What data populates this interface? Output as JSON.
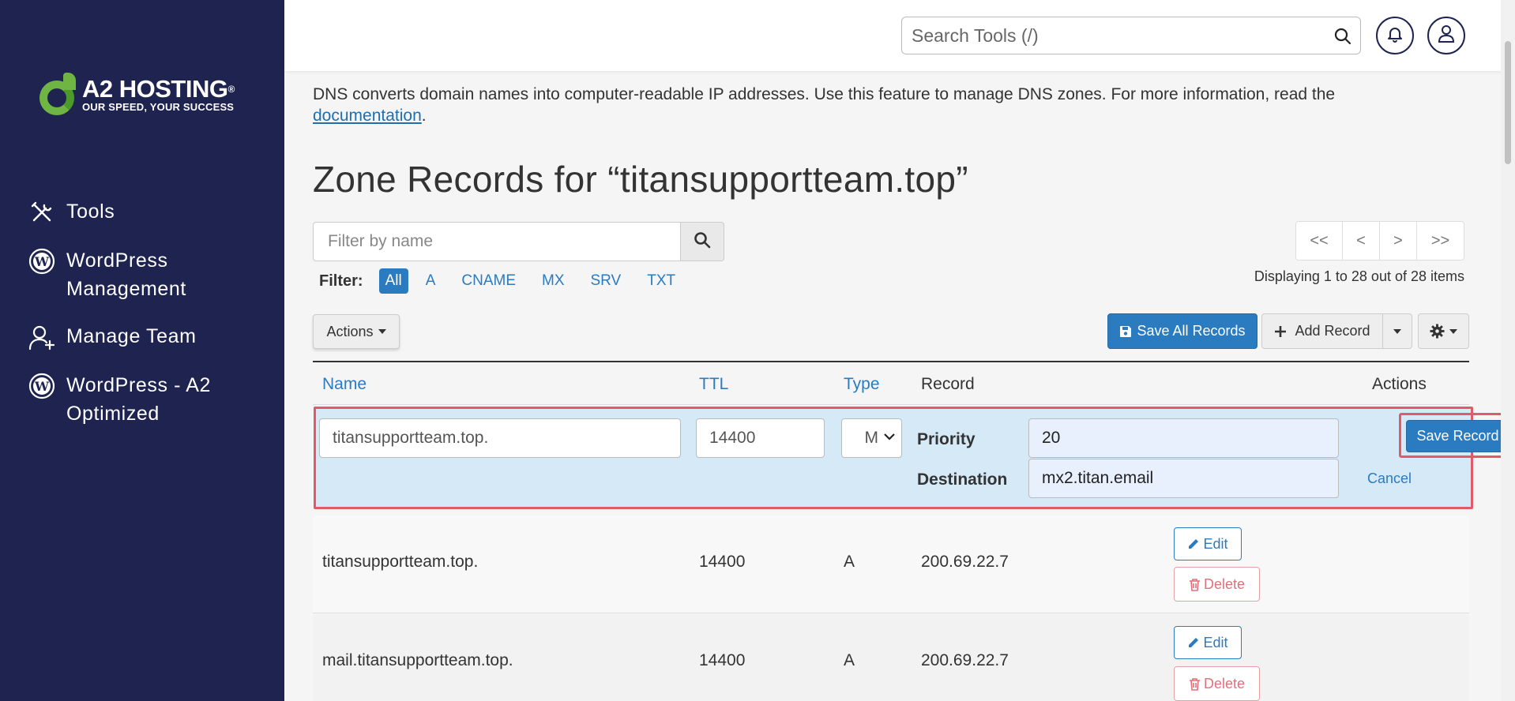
{
  "brand": {
    "name": "A2 HOSTING",
    "registered": "®",
    "tagline": "OUR SPEED, YOUR SUCCESS",
    "colors": {
      "sidebar": "#1e2350",
      "logo_green": "#6fb544",
      "accent_blue": "#2b7bc1",
      "highlight_red": "#e05a67"
    }
  },
  "sidebar": {
    "items": [
      {
        "label": "Tools",
        "icon": "tools-icon"
      },
      {
        "label": "WordPress Management",
        "icon": "wordpress-icon"
      },
      {
        "label": "Manage Team",
        "icon": "add-user-icon"
      },
      {
        "label": "WordPress - A2 Optimized",
        "icon": "wordpress-icon"
      }
    ]
  },
  "header": {
    "search_placeholder": "Search Tools (/)"
  },
  "main": {
    "description": "DNS converts domain names into computer-readable IP addresses. Use this feature to manage DNS zones. For more information, read the",
    "description_link": "documentation",
    "description_end": ".",
    "title": "Zone Records for “titansupportteam.top”",
    "filter_placeholder": "Filter by name",
    "filter_label": "Filter:",
    "filter_options": [
      "All",
      "A",
      "CNAME",
      "MX",
      "SRV",
      "TXT"
    ],
    "active_filter": "All",
    "pager": [
      "<<",
      "<",
      ">",
      ">>"
    ],
    "displaying": "Displaying 1 to 28 out of 28 items",
    "actions_label": "Actions",
    "save_all_label": "Save All Records",
    "add_record_label": "Add Record",
    "columns": [
      "Name",
      "TTL",
      "Type",
      "Record",
      "Actions"
    ],
    "edit_row": {
      "name": "titansupportteam.top.",
      "ttl": "14400",
      "type": "MX",
      "priority_label": "Priority",
      "priority": "20",
      "destination_label": "Destination",
      "destination": "mx2.titan.email",
      "save_label": "Save Record",
      "cancel_label": "Cancel"
    },
    "rows": [
      {
        "name": "titansupportteam.top.",
        "ttl": "14400",
        "type": "A",
        "record": "200.69.22.7",
        "edit": "Edit",
        "delete": "Delete"
      },
      {
        "name": "mail.titansupportteam.top.",
        "ttl": "14400",
        "type": "A",
        "record": "200.69.22.7",
        "edit": "Edit",
        "delete": "Delete"
      }
    ]
  }
}
